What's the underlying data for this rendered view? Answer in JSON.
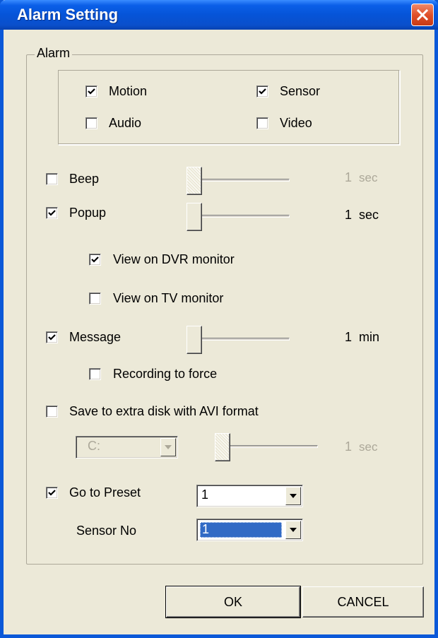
{
  "window": {
    "title": "Alarm Setting"
  },
  "group": {
    "legend": "Alarm"
  },
  "alarm_types": {
    "motion": {
      "label": "Motion",
      "checked": true
    },
    "sensor": {
      "label": "Sensor",
      "checked": true
    },
    "audio": {
      "label": "Audio",
      "checked": false
    },
    "video": {
      "label": "Video",
      "checked": false
    }
  },
  "beep": {
    "label": "Beep",
    "checked": false,
    "value": "1",
    "unit": "sec"
  },
  "popup": {
    "label": "Popup",
    "checked": true,
    "value": "1",
    "unit": "sec"
  },
  "view_dvr": {
    "label": "View on DVR monitor",
    "checked": true
  },
  "view_tv": {
    "label": "View on TV monitor",
    "checked": false
  },
  "message": {
    "label": "Message",
    "checked": true,
    "value": "1",
    "unit": "min"
  },
  "recording_force": {
    "label": "Recording to force",
    "checked": false
  },
  "save_extra": {
    "label": "Save to extra disk with AVI format",
    "checked": false,
    "drive": "C:",
    "value": "1",
    "unit": "sec"
  },
  "preset": {
    "label": "Go to Preset",
    "checked": true,
    "value": "1"
  },
  "sensor_no": {
    "label": "Sensor No",
    "value": "1"
  },
  "buttons": {
    "ok": "OK",
    "cancel": "CANCEL"
  }
}
